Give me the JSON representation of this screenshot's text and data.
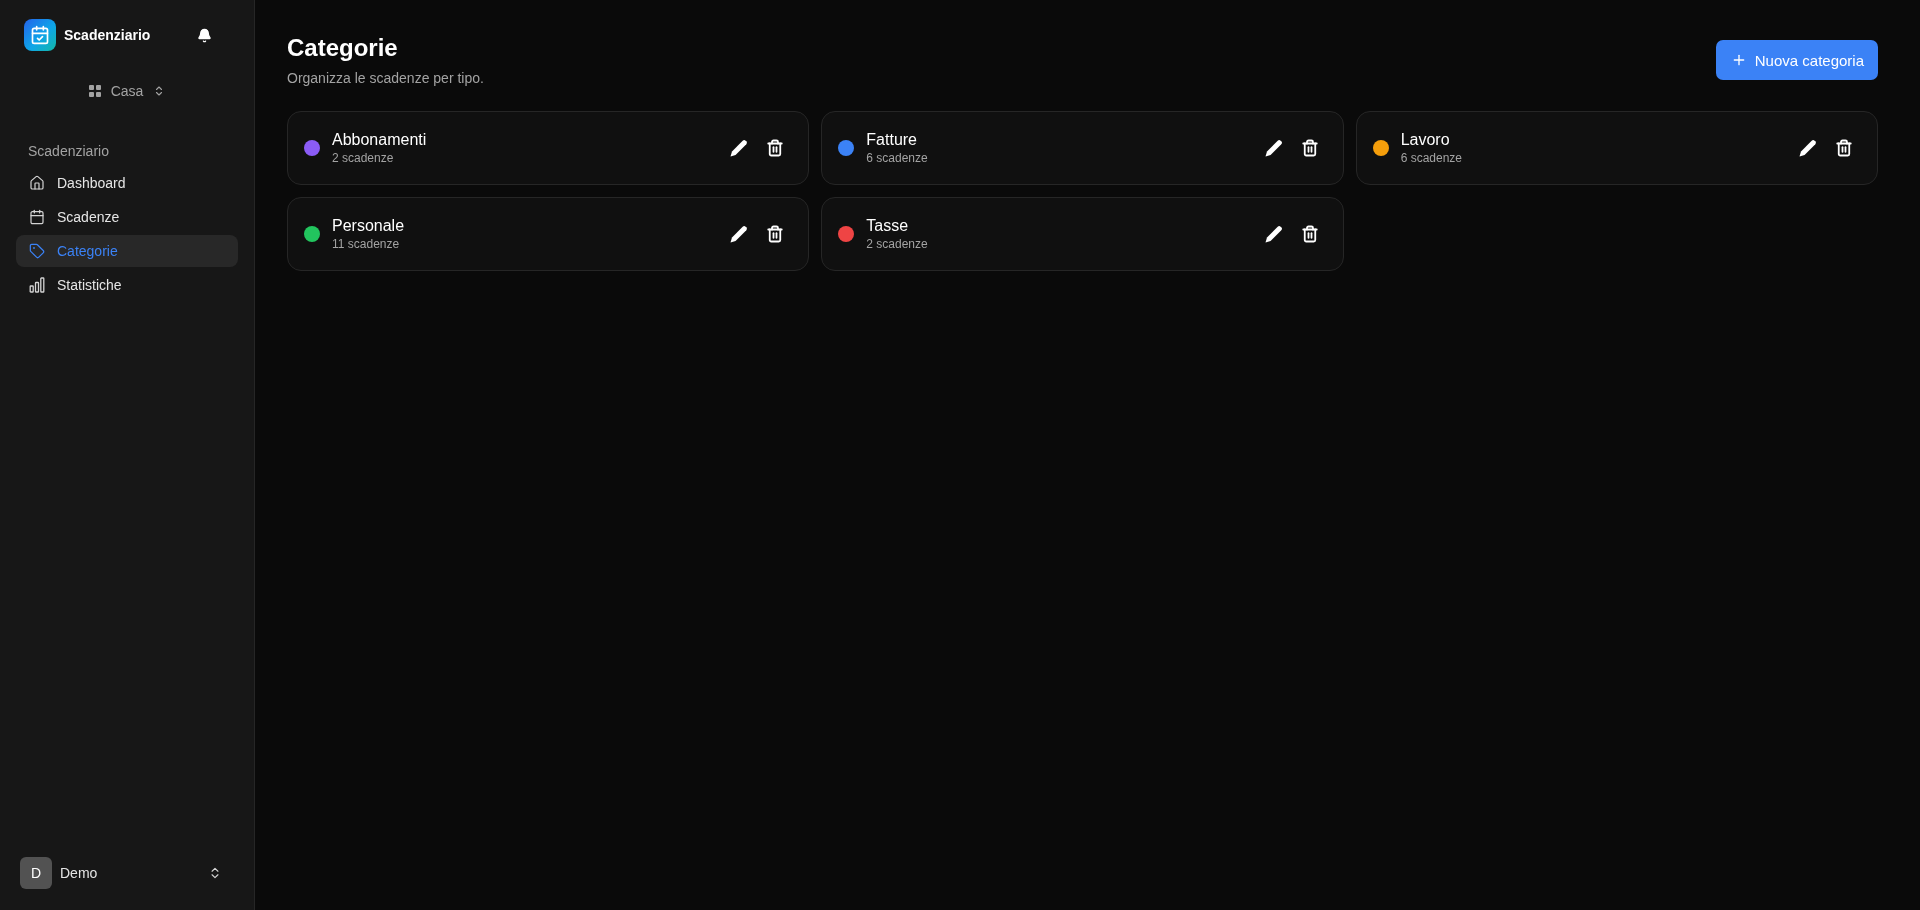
{
  "sidebar": {
    "app_title": "Scadenziario",
    "workspace": "Casa",
    "group_label": "Scadenziario",
    "items": [
      {
        "label": "Dashboard",
        "selected": false
      },
      {
        "label": "Scadenze",
        "selected": false
      },
      {
        "label": "Categorie",
        "selected": true
      },
      {
        "label": "Statistiche",
        "selected": false
      }
    ],
    "user": {
      "initial": "D",
      "name": "Demo"
    }
  },
  "header": {
    "title": "Categorie",
    "subtitle": "Organizza le scadenze per tipo.",
    "action": "Nuova categoria"
  },
  "categories": [
    {
      "name": "Abbonamenti",
      "count": "2 scadenze",
      "color": "#8b5cf6"
    },
    {
      "name": "Fatture",
      "count": "6 scadenze",
      "color": "#3b82f6"
    },
    {
      "name": "Lavoro",
      "count": "6 scadenze",
      "color": "#f59e0b"
    },
    {
      "name": "Personale",
      "count": "11 scadenze",
      "color": "#22c55e"
    },
    {
      "name": "Tasse",
      "count": "2 scadenze",
      "color": "#ef4444"
    }
  ]
}
